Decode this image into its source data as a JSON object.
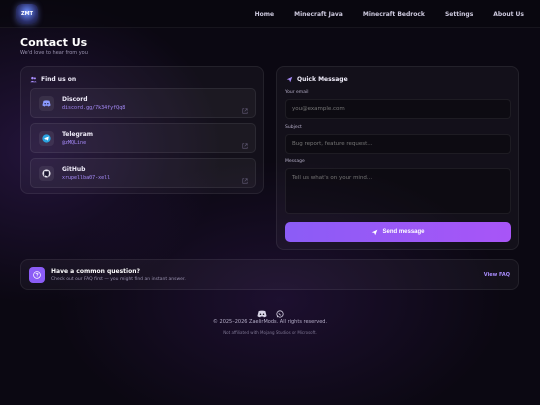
{
  "nav": {
    "logo_text": "ZMT",
    "links": [
      "Home",
      "Minecraft Java",
      "Minecraft Bedrock",
      "Settings",
      "About Us"
    ]
  },
  "page": {
    "title": "Contact Us",
    "subtitle": "We'd love to hear from you"
  },
  "find_us": {
    "title": "Find us on",
    "items": [
      {
        "name": "Discord",
        "value": "discord.gg/7k34fyfQq8",
        "icon": "discord-icon"
      },
      {
        "name": "Telegram",
        "value": "@zMQLine",
        "icon": "telegram-icon"
      },
      {
        "name": "GitHub",
        "value": "xrupellba07-xell",
        "icon": "github-icon"
      }
    ]
  },
  "quick_message": {
    "title": "Quick Message",
    "email_label": "Your email",
    "email_placeholder": "you@example.com",
    "subject_label": "Subject",
    "subject_placeholder": "Bug report, feature request...",
    "message_label": "Message",
    "message_placeholder": "Tell us what's on your mind...",
    "send_label": "Send message"
  },
  "faq": {
    "title": "Have a common question?",
    "subtitle": "Check out our FAQ first — you might find an instant answer.",
    "link": "View FAQ"
  },
  "footer": {
    "copyright": "© 2025–2026 ZaelirMods. All rights reserved.",
    "affiliation": "Not affiliated with Mojang Studios or Microsoft."
  },
  "colors": {
    "accent": "#8b5cf6",
    "accent_text": "#a78bfa",
    "background": "#0b0812"
  }
}
